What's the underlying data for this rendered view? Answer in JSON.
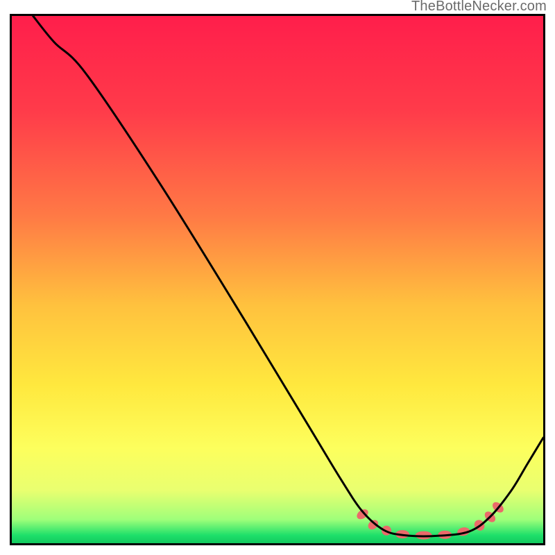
{
  "watermark": "TheBottleNecker.com",
  "chart_data": {
    "type": "line",
    "title": "",
    "xlabel": "",
    "ylabel": "",
    "xlim": [
      0,
      100
    ],
    "ylim": [
      0,
      100
    ],
    "gradient_stops": [
      {
        "offset": 0.0,
        "color": "#ff1e4b"
      },
      {
        "offset": 0.18,
        "color": "#ff3b4a"
      },
      {
        "offset": 0.38,
        "color": "#ff7a45"
      },
      {
        "offset": 0.55,
        "color": "#ffc23e"
      },
      {
        "offset": 0.7,
        "color": "#ffe83e"
      },
      {
        "offset": 0.82,
        "color": "#fdff5d"
      },
      {
        "offset": 0.9,
        "color": "#e9ff70"
      },
      {
        "offset": 0.955,
        "color": "#9fff7a"
      },
      {
        "offset": 0.985,
        "color": "#1ee06a"
      },
      {
        "offset": 1.0,
        "color": "#12c85e"
      }
    ],
    "series": [
      {
        "name": "curve",
        "stroke": "#000000",
        "stroke_width": 3,
        "points": [
          {
            "x": 4,
            "y": 100
          },
          {
            "x": 8,
            "y": 95
          },
          {
            "x": 14,
            "y": 89
          },
          {
            "x": 28,
            "y": 68
          },
          {
            "x": 44,
            "y": 42
          },
          {
            "x": 56,
            "y": 22
          },
          {
            "x": 62,
            "y": 12
          },
          {
            "x": 66,
            "y": 6
          },
          {
            "x": 70,
            "y": 2.5
          },
          {
            "x": 74,
            "y": 1.5
          },
          {
            "x": 80,
            "y": 1.4
          },
          {
            "x": 86,
            "y": 2.2
          },
          {
            "x": 90,
            "y": 5
          },
          {
            "x": 94,
            "y": 10
          },
          {
            "x": 97,
            "y": 15
          },
          {
            "x": 100,
            "y": 20
          }
        ]
      }
    ],
    "markers": {
      "color": "#ea6a6a",
      "points": [
        {
          "x": 66.0,
          "y": 5.5,
          "rx": 6,
          "ry": 9,
          "rot": 55
        },
        {
          "x": 68.0,
          "y": 3.5,
          "rx": 6,
          "ry": 8,
          "rot": 50
        },
        {
          "x": 70.5,
          "y": 2.4,
          "rx": 7,
          "ry": 7,
          "rot": 0
        },
        {
          "x": 73.5,
          "y": 1.7,
          "rx": 10,
          "ry": 6,
          "rot": 0
        },
        {
          "x": 77.5,
          "y": 1.5,
          "rx": 12,
          "ry": 6,
          "rot": 0
        },
        {
          "x": 81.5,
          "y": 1.6,
          "rx": 10,
          "ry": 6,
          "rot": 0
        },
        {
          "x": 85.0,
          "y": 2.2,
          "rx": 9,
          "ry": 6,
          "rot": -10
        },
        {
          "x": 88.0,
          "y": 3.4,
          "rx": 7,
          "ry": 8,
          "rot": -35
        },
        {
          "x": 90.0,
          "y": 5.0,
          "rx": 6,
          "ry": 9,
          "rot": -45
        },
        {
          "x": 91.5,
          "y": 6.8,
          "rx": 6,
          "ry": 9,
          "rot": -50
        }
      ]
    }
  }
}
